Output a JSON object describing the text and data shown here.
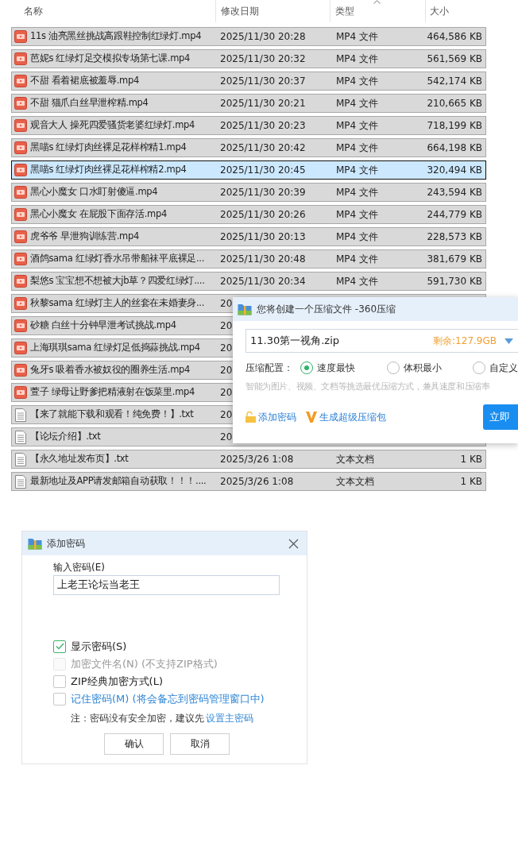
{
  "file_list": {
    "columns": [
      {
        "label": "名称",
        "sorted": false
      },
      {
        "label": "修改日期",
        "sorted": false
      },
      {
        "label": "类型",
        "sorted": true
      },
      {
        "label": "大小",
        "sorted": false
      }
    ],
    "rows": [
      {
        "kind": "video",
        "name": "11s 油亮黑丝挑战高跟鞋控制红绿灯.mp4",
        "modified": "2025/11/30 20:28",
        "type": "MP4 文件",
        "size": "464,586 KB",
        "selected": false
      },
      {
        "kind": "video",
        "name": "芭妮s 红绿灯足交模拟专场第七课.mp4",
        "modified": "2025/11/30 20:32",
        "type": "MP4 文件",
        "size": "561,569 KB",
        "selected": false
      },
      {
        "kind": "video",
        "name": "不甜 看着裙底被羞辱.mp4",
        "modified": "2025/11/30 20:37",
        "type": "MP4 文件",
        "size": "542,174 KB",
        "selected": false
      },
      {
        "kind": "video",
        "name": "不甜 猫爪白丝早泄榨精.mp4",
        "modified": "2025/11/30 20:21",
        "type": "MP4 文件",
        "size": "210,665 KB",
        "selected": false
      },
      {
        "kind": "video",
        "name": "观音大人 操死四爱骚货老婆红绿灯.mp4",
        "modified": "2025/11/30 20:23",
        "type": "MP4 文件",
        "size": "718,199 KB",
        "selected": false
      },
      {
        "kind": "video",
        "name": "黑喵s 红绿灯肉丝裸足花样榨精1.mp4",
        "modified": "2025/11/30 20:42",
        "type": "MP4 文件",
        "size": "664,198 KB",
        "selected": false
      },
      {
        "kind": "video",
        "name": "黑喵s 红绿灯肉丝裸足花样榨精2.mp4",
        "modified": "2025/11/30 20:45",
        "type": "MP4 文件",
        "size": "320,494 KB",
        "selected": true
      },
      {
        "kind": "video",
        "name": "黑心小魔女 口水盯射傻逼.mp4",
        "modified": "2025/11/30 20:39",
        "type": "MP4 文件",
        "size": "243,594 KB",
        "selected": false
      },
      {
        "kind": "video",
        "name": "黑心小魔女 在屁股下面存活.mp4",
        "modified": "2025/11/30 20:26",
        "type": "MP4 文件",
        "size": "244,779 KB",
        "selected": false
      },
      {
        "kind": "video",
        "name": "虎爷爷 早泄狗训练营.mp4",
        "modified": "2025/11/30 20:13",
        "type": "MP4 文件",
        "size": "228,573 KB",
        "selected": false
      },
      {
        "kind": "video",
        "name": "酒鸽sama 红绿灯香水吊带船袜平底裸足...",
        "modified": "2025/11/30 20:48",
        "type": "MP4 文件",
        "size": "381,679 KB",
        "selected": false
      },
      {
        "kind": "video",
        "name": "梨悠s 宝宝想不想被大jb草？四爱红绿灯....",
        "modified": "2025/11/30 20:34",
        "type": "MP4 文件",
        "size": "591,730 KB",
        "selected": false
      },
      {
        "kind": "video",
        "name": "秋黎sama 红绿灯主人的丝套在未婚妻身...",
        "modified": "20",
        "selected": false
      },
      {
        "kind": "video",
        "name": "砂糖 白丝十分钟早泄考试挑战.mp4",
        "modified": "20",
        "selected": false
      },
      {
        "kind": "video",
        "name": "上海琪琪sama 红绿灯足低捣蒜挑战.mp4",
        "modified": "20",
        "selected": false
      },
      {
        "kind": "video",
        "name": "兔牙s 吸着香水被奴役的圈养生活.mp4",
        "modified": "20",
        "selected": false
      },
      {
        "kind": "video",
        "name": "萱子 绿母让野爹把精液射在饭菜里.mp4",
        "modified": "20",
        "selected": false
      },
      {
        "kind": "text",
        "name": "【来了就能下载和观看！纯免费！】.txt",
        "modified": "20",
        "selected": false
      },
      {
        "kind": "text",
        "name": "【论坛介绍】.txt",
        "modified": "20",
        "selected": false
      },
      {
        "kind": "text",
        "name": "【永久地址发布页】.txt",
        "modified": "2025/3/26 1:08",
        "type": "文本文档",
        "size": "1 KB",
        "selected": false
      },
      {
        "kind": "text",
        "name": "最新地址及APP请发邮箱自动获取！！！....",
        "modified": "2025/3/26 1:08",
        "type": "文本文档",
        "size": "1 KB",
        "selected": false
      }
    ]
  },
  "compress_dialog": {
    "title": "您将创建一个压缩文件 -360压缩",
    "archive_name": "11.30第一视角.zip",
    "free_space": "剩余:127.9GB",
    "config_label": "压缩配置：",
    "options": [
      {
        "label": "速度最快",
        "selected": true
      },
      {
        "label": "体积最小",
        "selected": false
      },
      {
        "label": "自定义",
        "selected": false
      }
    ],
    "hint": "智能为图片、视频、文档等挑选最优压缩方式，兼具速度和压缩率",
    "links": [
      {
        "kind": "password",
        "label": "添加密码"
      },
      {
        "kind": "super",
        "label": "生成超级压缩包"
      }
    ],
    "primary_button": "立即"
  },
  "password_dialog": {
    "title": "添加密码",
    "field_label": "输入密码(E)",
    "value": "上老王论坛当老王",
    "checkboxes": [
      {
        "kind": "plain",
        "label": "显示密码(S)",
        "checked": true,
        "disabled": false
      },
      {
        "kind": "plain",
        "label": "加密文件名(N) (不支持ZIP格式)",
        "checked": false,
        "disabled": true
      },
      {
        "kind": "plain",
        "label": "ZIP经典加密方式(L)",
        "checked": false,
        "disabled": false
      },
      {
        "kind": "link",
        "label": "记住密码(M) (将会备忘到密码管理窗口中)",
        "checked": false,
        "disabled": false
      }
    ],
    "note": {
      "text": "注：密码没有安全加密，建议先",
      "link": "设置主密码"
    },
    "buttons": [
      "确认",
      "取消"
    ]
  }
}
